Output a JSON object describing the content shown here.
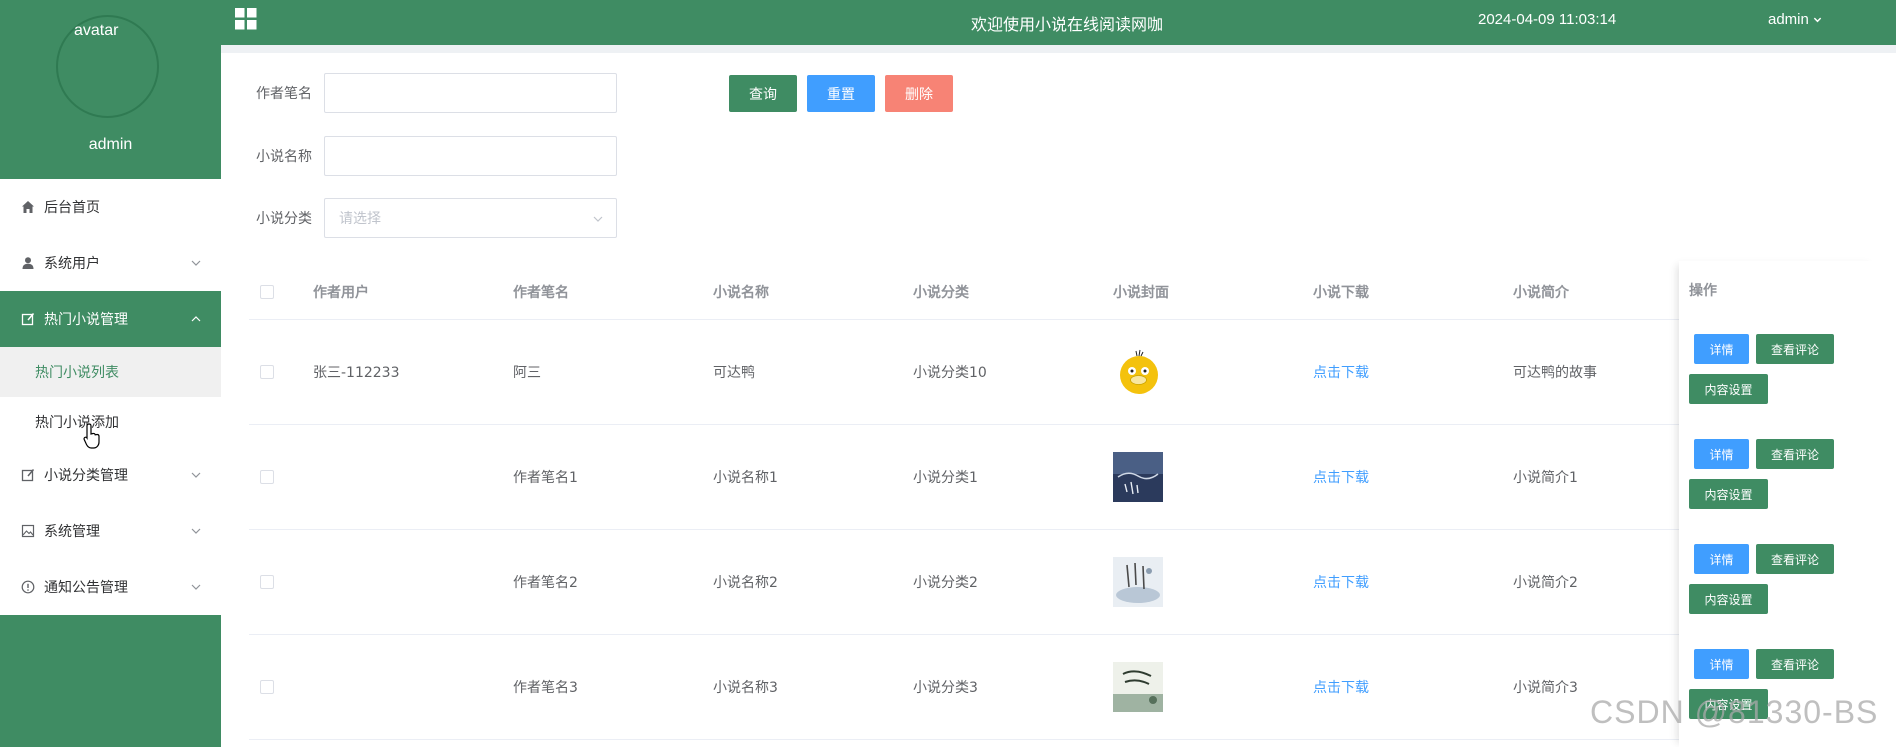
{
  "sidebar": {
    "avatar_alt": "avatar",
    "username": "admin",
    "menu": [
      {
        "label": "后台首页",
        "icon": "home-icon"
      },
      {
        "label": "系统用户",
        "icon": "user-icon"
      },
      {
        "label": "热门小说管理",
        "icon": "edit-doc-icon",
        "active": true,
        "children": [
          {
            "label": "热门小说列表",
            "current": true
          },
          {
            "label": "热门小说添加"
          }
        ]
      },
      {
        "label": "小说分类管理",
        "icon": "edit-doc-icon"
      },
      {
        "label": "系统管理",
        "icon": "picture-icon"
      },
      {
        "label": "通知公告管理",
        "icon": "info-icon"
      }
    ]
  },
  "header": {
    "welcome": "欢迎使用小说在线阅读网咖",
    "datetime": "2024-04-09 11:03:14",
    "user": "admin"
  },
  "search": {
    "author_label": "作者笔名",
    "author_value": "",
    "novel_label": "小说名称",
    "novel_value": "",
    "category_label": "小说分类",
    "category_placeholder": "请选择",
    "query_btn": "查询",
    "reset_btn": "重置",
    "delete_btn": "删除"
  },
  "table": {
    "columns": [
      "作者用户",
      "作者笔名",
      "小说名称",
      "小说分类",
      "小说封面",
      "小说下载",
      "小说简介",
      "操作"
    ],
    "rows": [
      {
        "user": "张三-112233",
        "pen_name": "阿三",
        "novel": "可达鸭",
        "category": "小说分类10",
        "download": "点击下载",
        "intro": "可达鸭的故事"
      },
      {
        "user": "",
        "pen_name": "作者笔名1",
        "novel": "小说名称1",
        "category": "小说分类1",
        "download": "点击下载",
        "intro": "小说简介1"
      },
      {
        "user": "",
        "pen_name": "作者笔名2",
        "novel": "小说名称2",
        "category": "小说分类2",
        "download": "点击下载",
        "intro": "小说简介2"
      },
      {
        "user": "",
        "pen_name": "作者笔名3",
        "novel": "小说名称3",
        "category": "小说分类3",
        "download": "点击下载",
        "intro": "小说简介3"
      }
    ],
    "ops": {
      "detail": "详情",
      "comment": "查看评论",
      "content": "内容设置"
    }
  },
  "watermark": "CSDN @81330-BS",
  "colors": {
    "primary": "#3f8c63",
    "blue": "#409eff",
    "danger": "#f78375"
  }
}
